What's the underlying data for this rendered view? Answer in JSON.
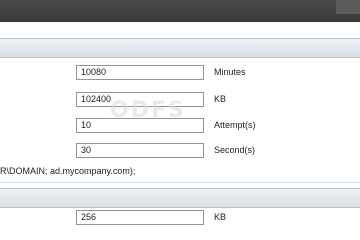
{
  "watermark_text": "ODFS",
  "settings": {
    "rows": [
      {
        "value": "10080",
        "unit": "Minutes"
      },
      {
        "value": "102400",
        "unit": "KB"
      },
      {
        "value": "10",
        "unit": "Attempt(s)"
      },
      {
        "value": "30",
        "unit": "Second(s)"
      }
    ],
    "note": "R\\DOMAIN; ad.mycompany.com);"
  },
  "second_section": {
    "rows": [
      {
        "value": "256",
        "unit": "KB"
      }
    ]
  }
}
